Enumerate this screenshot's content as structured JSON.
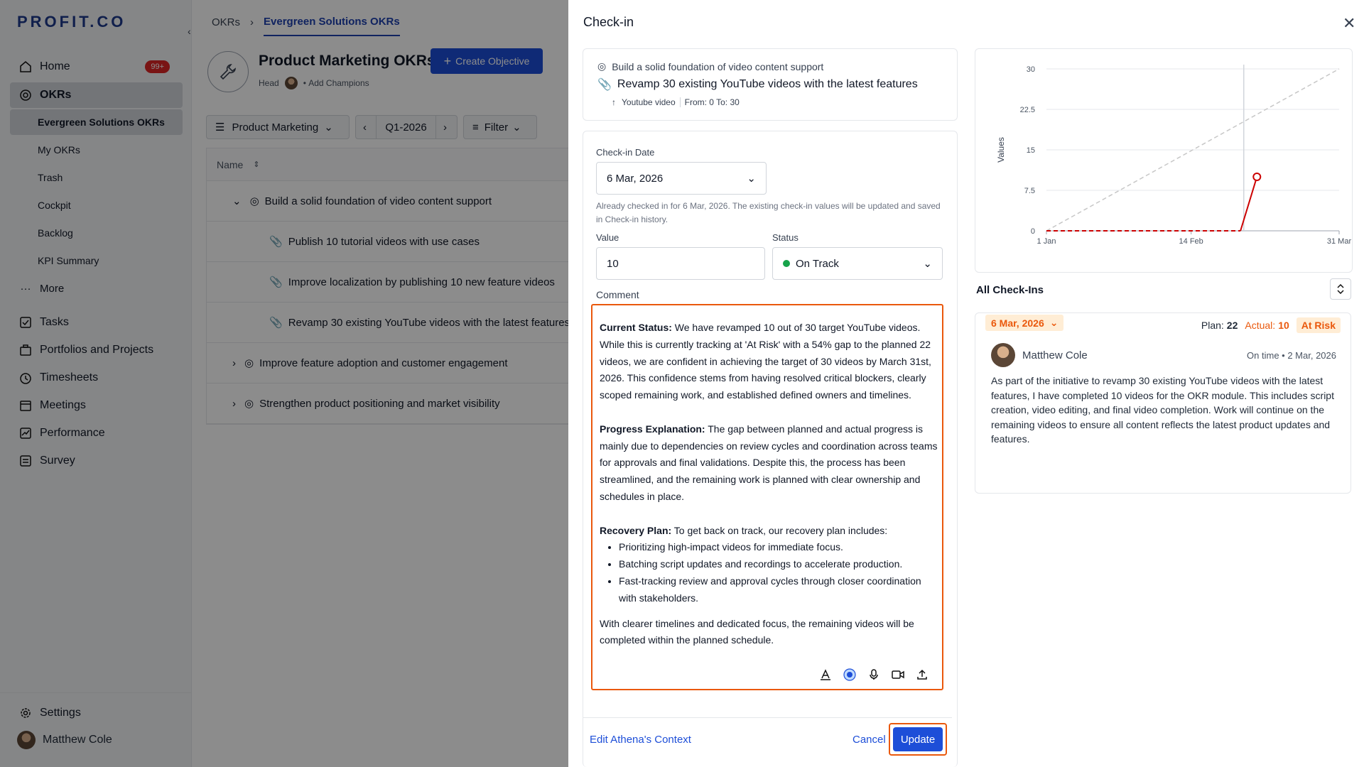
{
  "sidebar": {
    "logo": "PROFIT.CO",
    "home": {
      "label": "Home",
      "badge": "99+"
    },
    "okrs": "OKRs",
    "okr_sub": [
      "Evergreen Solutions OKRs",
      "My OKRs",
      "Trash",
      "Cockpit",
      "Backlog",
      "KPI Summary"
    ],
    "more": "More",
    "items": [
      "Tasks",
      "Portfolios and Projects",
      "Timesheets",
      "Meetings",
      "Performance",
      "Survey"
    ],
    "settings": "Settings",
    "user": "Matthew Cole"
  },
  "main": {
    "breadcrumb_root": "OKRs",
    "breadcrumb_current": "Evergreen Solutions OKRs",
    "title": "Product Marketing OKRs",
    "head_label": "Head",
    "add_champions": "Add Champions",
    "create_button": "Create Objective",
    "team_select": "Product Marketing",
    "period": "Q1-2026",
    "filter": "Filter",
    "column_name": "Name",
    "rows": [
      {
        "text": "Build a solid foundation of video content support",
        "kind": "objective",
        "expanded": true
      },
      {
        "text": "Publish 10 tutorial videos with use cases",
        "kind": "kr"
      },
      {
        "text": "Improve localization by publishing 10 new feature videos",
        "kind": "kr"
      },
      {
        "text": "Revamp 30 existing YouTube videos with the latest features",
        "kind": "kr"
      },
      {
        "text": "Improve feature adoption and customer engagement",
        "kind": "objective",
        "expanded": false
      },
      {
        "text": "Strengthen product positioning and market visibility",
        "kind": "objective",
        "expanded": false
      }
    ]
  },
  "checkin": {
    "title": "Check-in",
    "objective": "Build a solid foundation of video content support",
    "key_result": "Revamp 30 existing YouTube videos with the latest features",
    "metric_name": "Youtube video",
    "metric_range": "From: 0 To: 30",
    "date_label": "Check-in Date",
    "date_value": "6 Mar, 2026",
    "date_hint": "Already checked in for 6 Mar, 2026. The existing check-in values will be updated and saved in Check-in history.",
    "value_label": "Value",
    "value": "10",
    "status_label": "Status",
    "status": "On Track",
    "status_color": "#16a34a",
    "comment_label": "Comment",
    "comment": {
      "status_heading": "Current Status:",
      "status_text": " We have revamped 10 out of 30 target YouTube videos. While this is currently tracking at 'At Risk' with a 54% gap to the planned 22 videos, we are confident in achieving the target of 30 videos by March 31st, 2026. This confidence stems from having resolved critical blockers, clearly scoped remaining work, and established defined owners and timelines.",
      "progress_heading": "Progress Explanation:",
      "progress_text": " The gap between planned and actual progress is mainly due to dependencies on review cycles and coordination across teams for approvals and final validations. Despite this, the process has been streamlined, and the remaining work is planned with clear ownership and schedules in place.",
      "recovery_heading": "Recovery Plan:",
      "recovery_text": " To get back on track, our recovery plan includes:",
      "bullets": [
        "Prioritizing high-impact videos for immediate focus.",
        "Batching script updates and recordings to accelerate production.",
        "Fast-tracking review and approval cycles through closer coordination with stakeholders."
      ],
      "closing": "With clearer timelines and dedicated focus, the remaining videos will be completed within the planned schedule."
    },
    "edit_context": "Edit Athena's Context",
    "cancel": "Cancel",
    "update": "Update"
  },
  "chart_data": {
    "type": "line",
    "ylabel": "Values",
    "x_ticks": [
      "1 Jan",
      "14 Feb",
      "31 Mar"
    ],
    "y_ticks": [
      "0",
      "7.5",
      "15",
      "22.5",
      "30"
    ],
    "ylim": [
      0,
      30
    ],
    "series": [
      {
        "style": "planned-dashed",
        "color": "#c7c7c7",
        "x": [
          "1 Jan",
          "31 Mar"
        ],
        "y": [
          0,
          30
        ]
      },
      {
        "style": "actual",
        "color": "#cc0000",
        "x": [
          "1 Jan",
          "1 Mar",
          "6 Mar"
        ],
        "y": [
          0,
          0,
          10
        ]
      }
    ],
    "marker": {
      "x": "6 Mar",
      "y": 10
    },
    "current_line_x": "2 Mar",
    "grid": true
  },
  "history": {
    "title": "All Check-Ins",
    "date": "6 Mar, 2026",
    "plan_label": "Plan:",
    "plan_value": "22",
    "actual_label": "Actual:",
    "actual_value": "10",
    "status": "At Risk",
    "user": "Matthew Cole",
    "meta": "On time • 2 Mar, 2026",
    "body": "As part of the initiative to revamp 30 existing YouTube videos with the latest features, I have completed 10 videos for the OKR module. This includes script creation, video editing, and final video completion. Work will continue on the remaining videos to ensure all content reflects the latest product updates and features."
  }
}
